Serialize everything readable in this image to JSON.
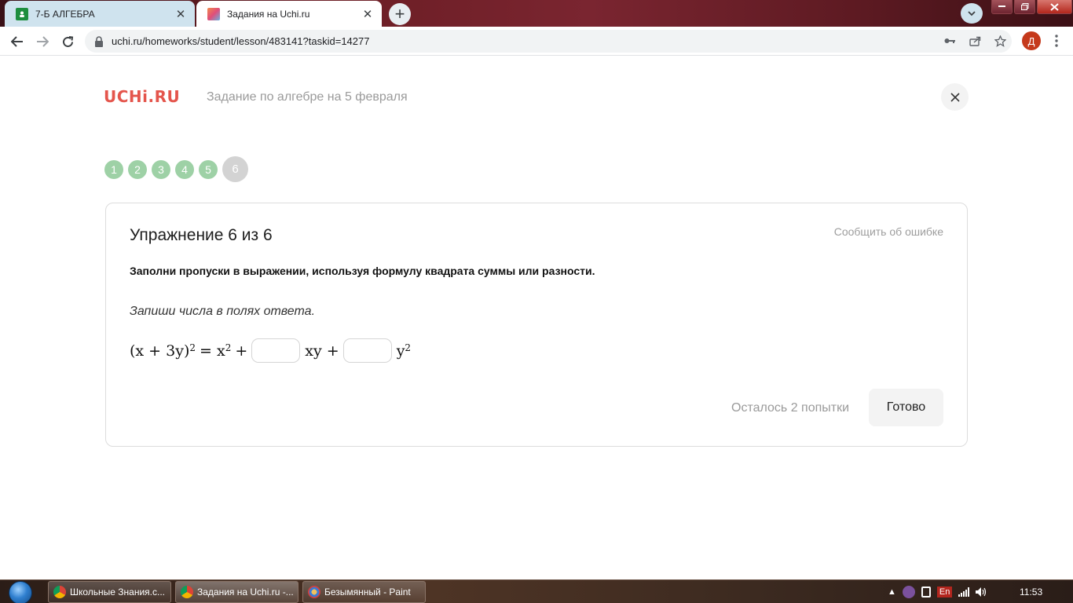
{
  "browser": {
    "tabs": [
      {
        "label": "7-Б АЛГЕБРА",
        "active": false,
        "icon": "classroom-icon"
      },
      {
        "label": "Задания на Uchi.ru",
        "active": true,
        "icon": "uchi-favicon"
      }
    ],
    "new_tab": "+",
    "url": "uchi.ru/homeworks/student/lesson/483141?taskid=14277",
    "profile_initial": "Д"
  },
  "page": {
    "logo": "UCHi.RU",
    "homework_title": "Задание по алгебре на 5 февраля",
    "steps": [
      "1",
      "2",
      "3",
      "4",
      "5",
      "6"
    ],
    "current_step": "6"
  },
  "exercise": {
    "title": "Упражнение 6 из 6",
    "report_link": "Сообщить об ошибке",
    "instruction": "Заполни пропуски в выражении, используя формулу квадрата суммы или разности.",
    "hint": "Запиши числа в полях ответа.",
    "formula": {
      "lhs": "(x + 3y)",
      "lhs_exp": "2",
      "eq": "= x",
      "x_exp": "2",
      "plus1": "+",
      "term1": "xy +",
      "term2": "y",
      "y_exp": "2"
    },
    "answer1": "",
    "answer2": "",
    "attempts": "Осталось 2 попытки",
    "done_button": "Готово"
  },
  "taskbar": {
    "items": [
      {
        "label": "Школьные Знания.с..."
      },
      {
        "label": "Задания на Uchi.ru -..."
      },
      {
        "label": "Безымянный - Paint"
      }
    ],
    "lang": "En",
    "time": "11:53"
  }
}
